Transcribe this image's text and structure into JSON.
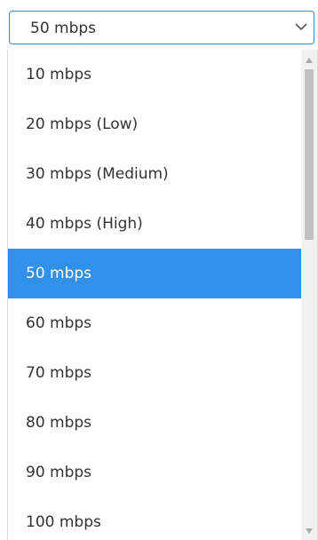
{
  "select": {
    "value": "50 mbps",
    "icon": "chevron-down-icon",
    "border_color": "#2e8be6"
  },
  "options": [
    {
      "label": "10 mbps",
      "selected": false
    },
    {
      "label": "20 mbps (Low)",
      "selected": false
    },
    {
      "label": "30 mbps (Medium)",
      "selected": false
    },
    {
      "label": "40 mbps (High)",
      "selected": false
    },
    {
      "label": "50 mbps",
      "selected": true
    },
    {
      "label": "60 mbps",
      "selected": false
    },
    {
      "label": "70 mbps",
      "selected": false
    },
    {
      "label": "80 mbps",
      "selected": false
    },
    {
      "label": "90 mbps",
      "selected": false
    },
    {
      "label": "100 mbps",
      "selected": false
    }
  ],
  "colors": {
    "selected_bg": "#3190e8",
    "selected_text": "#ffffff",
    "text": "#333333"
  },
  "scrollbar": {
    "up_icon": "scroll-up-arrow-icon",
    "down_icon": "scroll-down-arrow-icon",
    "position_fraction": 0
  }
}
